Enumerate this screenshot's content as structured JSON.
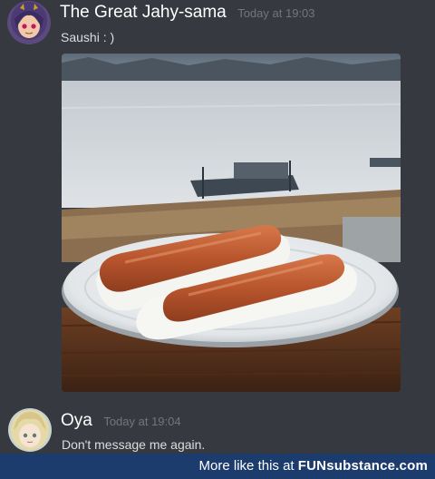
{
  "messages": [
    {
      "username": "The Great Jahy-sama",
      "timestamp": "Today at 19:03",
      "text": "Saushi  : )",
      "avatar_icon": "anime-girl-purple-hair",
      "attachment_icon": "sausage-sushi-photo"
    },
    {
      "username": "Oya",
      "timestamp": "Today at 19:04",
      "text": "Don't message me again.",
      "avatar_icon": "anime-blonde-character"
    }
  ],
  "watermark": {
    "prefix": "More like this at ",
    "logo": "FUNsubstance.com"
  },
  "colors": {
    "background": "#36393f",
    "username": "#ffffff",
    "timestamp": "#72767d",
    "message_text": "#dcddde",
    "watermark_bar": "#1c3c6e"
  }
}
